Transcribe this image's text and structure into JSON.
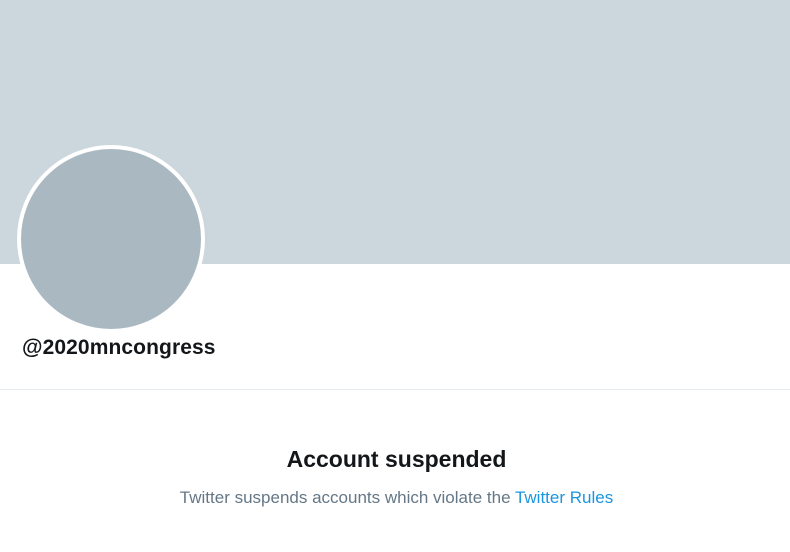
{
  "profile": {
    "handle": "@2020mncongress"
  },
  "notice": {
    "title": "Account suspended",
    "description": "Twitter suspends accounts which violate the",
    "link_label": "Twitter Rules"
  },
  "colors": {
    "banner": "#ccd6dd",
    "avatar": "#aab8c2",
    "text_primary": "#14171a",
    "text_secondary": "#657786",
    "link": "#1b95e0"
  }
}
